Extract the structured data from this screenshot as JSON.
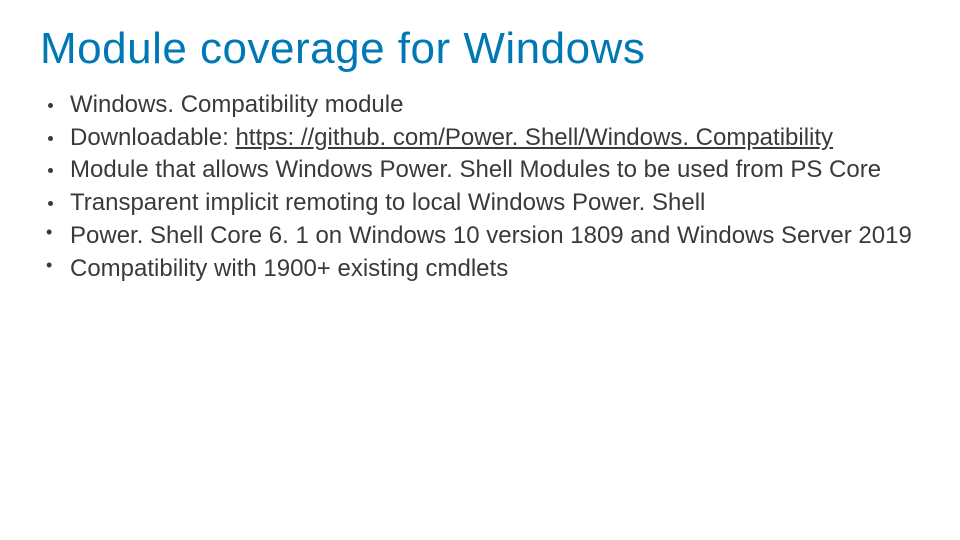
{
  "title": "Module coverage for Windows",
  "bullets": [
    {
      "style": "disc",
      "text": "Windows. Compatibility module"
    },
    {
      "style": "disc",
      "prefix": "Downloadable: ",
      "linkText": "https: //github. com/Power. Shell/Windows. Compatibility"
    },
    {
      "style": "disc",
      "text": "Module that allows Windows Power. Shell Modules to be used from PS Core"
    },
    {
      "style": "disc",
      "text": "Transparent implicit remoting to local Windows Power. Shell"
    },
    {
      "style": "dot",
      "text": "Power. Shell Core 6. 1 on Windows 10 version 1809 and Windows Server 2019"
    },
    {
      "style": "dot",
      "text": "Compatibility with 1900+ existing cmdlets"
    }
  ]
}
